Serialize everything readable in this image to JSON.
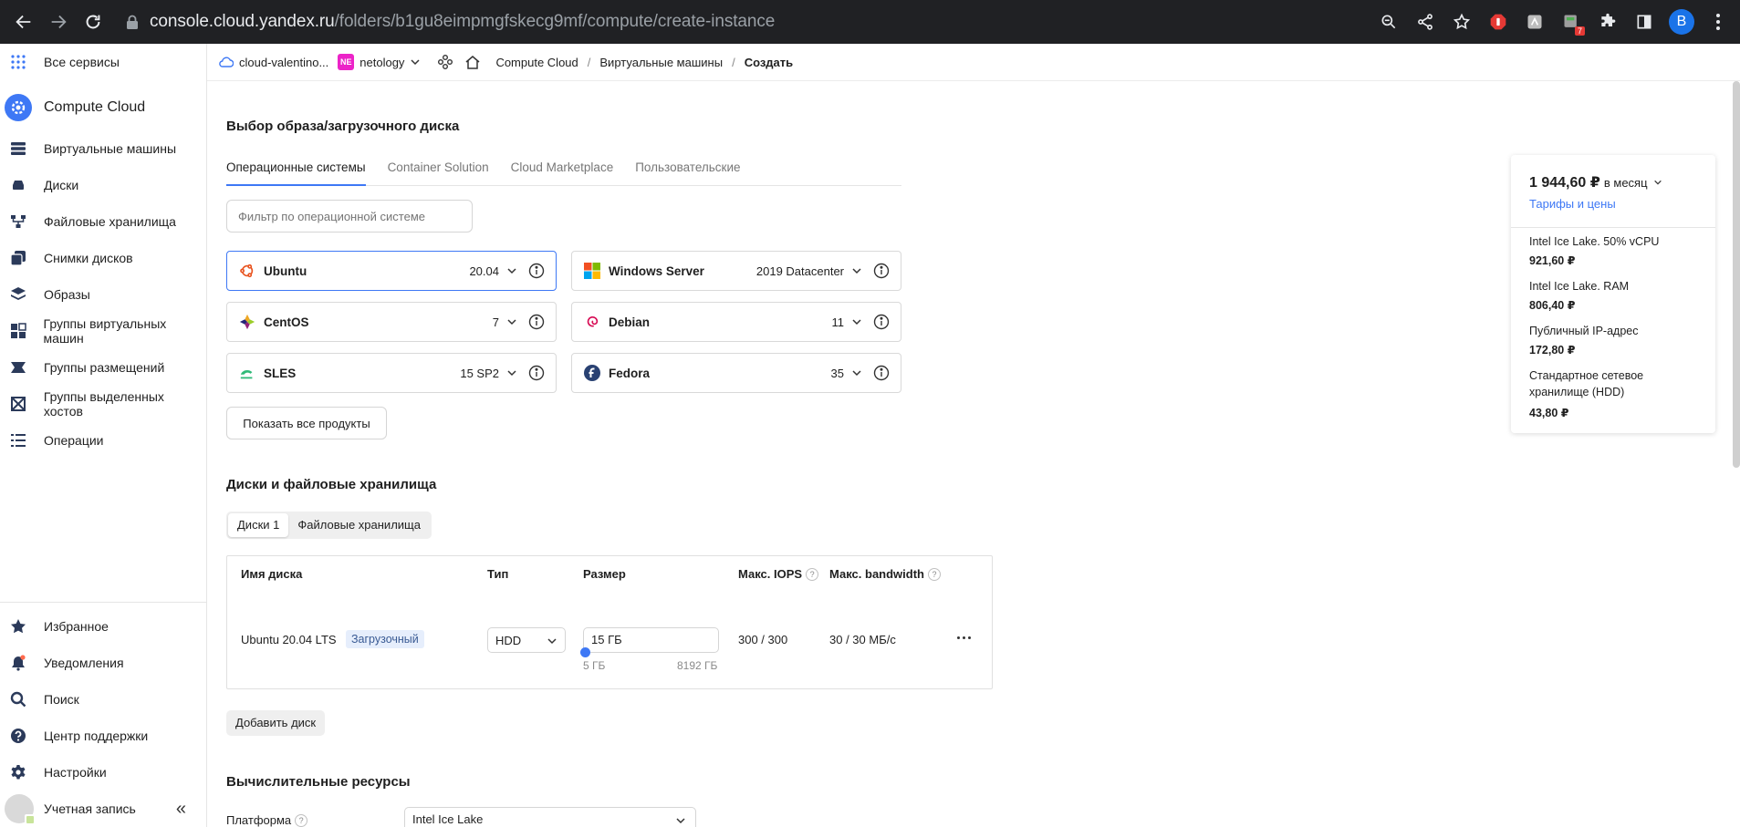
{
  "browser": {
    "url_host": "console.cloud.yandex.ru",
    "url_path": "/folders/b1gu8eimpmgfskecg9mf/compute/create-instance",
    "notification_badge": "7",
    "profile_initial": "B"
  },
  "sidebar": {
    "all_services": "Все сервисы",
    "service_title": "Compute Cloud",
    "items": [
      {
        "label": "Виртуальные машины",
        "icon": "servers-icon"
      },
      {
        "label": "Диски",
        "icon": "disk-icon"
      },
      {
        "label": "Файловые хранилища",
        "icon": "file-storage-icon"
      },
      {
        "label": "Снимки дисков",
        "icon": "snapshot-icon"
      },
      {
        "label": "Образы",
        "icon": "layers-icon"
      },
      {
        "label": "Группы виртуальных машин",
        "icon": "instance-groups-icon"
      },
      {
        "label": "Группы размещений",
        "icon": "placement-groups-icon"
      },
      {
        "label": "Группы выделенных хостов",
        "icon": "host-groups-icon"
      },
      {
        "label": "Операции",
        "icon": "operations-icon"
      }
    ],
    "bottom": [
      {
        "label": "Избранное",
        "icon": "star-icon"
      },
      {
        "label": "Уведомления",
        "icon": "bell-icon"
      },
      {
        "label": "Поиск",
        "icon": "search-icon"
      },
      {
        "label": "Центр поддержки",
        "icon": "help-icon"
      },
      {
        "label": "Настройки",
        "icon": "gear-icon"
      },
      {
        "label": "Учетная запись",
        "icon": "avatar"
      }
    ]
  },
  "topbar": {
    "cloud": "cloud-valentino...",
    "folder_badge": "NE",
    "folder": "netology",
    "crumbs": [
      "Compute Cloud",
      "Виртуальные машины",
      "Создать"
    ]
  },
  "image_section": {
    "title": "Выбор образа/загрузочного диска",
    "tabs": [
      "Операционные системы",
      "Container Solution",
      "Cloud Marketplace",
      "Пользовательские"
    ],
    "filter_placeholder": "Фильтр по операционной системе",
    "os": [
      {
        "name": "Ubuntu",
        "version": "20.04"
      },
      {
        "name": "Windows Server",
        "version": "2019 Datacenter"
      },
      {
        "name": "CentOS",
        "version": "7"
      },
      {
        "name": "Debian",
        "version": "11"
      },
      {
        "name": "SLES",
        "version": "15 SP2"
      },
      {
        "name": "Fedora",
        "version": "35"
      }
    ],
    "show_all": "Показать все продукты"
  },
  "disks_section": {
    "title": "Диски и файловые хранилища",
    "tabs": [
      "Диски 1",
      "Файловые хранилища"
    ],
    "headers": {
      "name": "Имя диска",
      "type": "Тип",
      "size": "Размер",
      "iops": "Макс. IOPS",
      "bandwidth": "Макс. bandwidth"
    },
    "row": {
      "name": "Ubuntu 20.04 LTS",
      "badge": "Загрузочный",
      "type": "HDD",
      "size": "15 ГБ",
      "min": "5 ГБ",
      "max": "8192 ГБ",
      "iops": "300 / 300",
      "bandwidth": "30 / 30 МБ/с"
    },
    "add_disk": "Добавить диск"
  },
  "compute_section": {
    "title": "Вычислительные ресурсы",
    "platform_label": "Платформа",
    "platform_value": "Intel Ice Lake"
  },
  "price": {
    "total": "1 944,60 ₽",
    "period": "в месяц",
    "link": "Тарифы и цены",
    "lines": [
      {
        "label": "Intel Ice Lake. 50% vCPU",
        "value": "921,60 ₽"
      },
      {
        "label": "Intel Ice Lake. RAM",
        "value": "806,40 ₽"
      },
      {
        "label": "Публичный IP-адрес",
        "value": "172,80 ₽"
      },
      {
        "label": "Стандартное сетевое хранилище (HDD)",
        "value": "43,80 ₽"
      }
    ]
  },
  "colors": {
    "accent": "#3e78f5",
    "chrome_bg": "#202124",
    "badge_pink": "#ec23c8"
  }
}
